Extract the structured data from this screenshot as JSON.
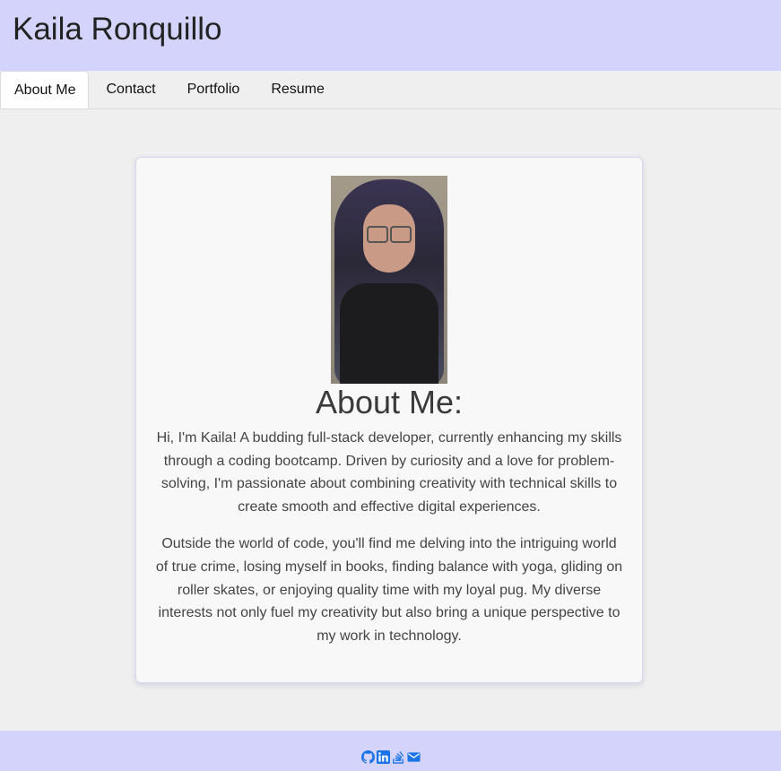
{
  "header": {
    "title": "Kaila Ronquillo"
  },
  "nav": {
    "tabs": [
      {
        "label": "About Me",
        "active": true
      },
      {
        "label": "Contact"
      },
      {
        "label": "Portfolio"
      },
      {
        "label": "Resume"
      }
    ]
  },
  "about": {
    "heading": "About Me:",
    "paragraphs": [
      "Hi, I'm Kaila! A budding full-stack developer, currently enhancing my skills through a coding bootcamp. Driven by curiosity and a love for problem-solving, I'm passionate about combining creativity with technical skills to create smooth and effective digital experiences.",
      "Outside the world of code, you'll find me delving into the intriguing world of true crime, losing myself in books, finding balance with yoga, gliding on roller skates, or enjoying quality time with my loyal pug. My diverse interests not only fuel my creativity but also bring a unique perspective to my work in technology."
    ]
  },
  "footer": {
    "icons": [
      "github-icon",
      "linkedin-icon",
      "stack-overflow-icon",
      "email-icon"
    ],
    "icon_color": "#1a73e8"
  },
  "colors": {
    "header_bg": "#d3d3fb",
    "footer_bg": "#d3d3fb",
    "page_bg": "#efefef",
    "card_bg": "#f8f8f8"
  }
}
